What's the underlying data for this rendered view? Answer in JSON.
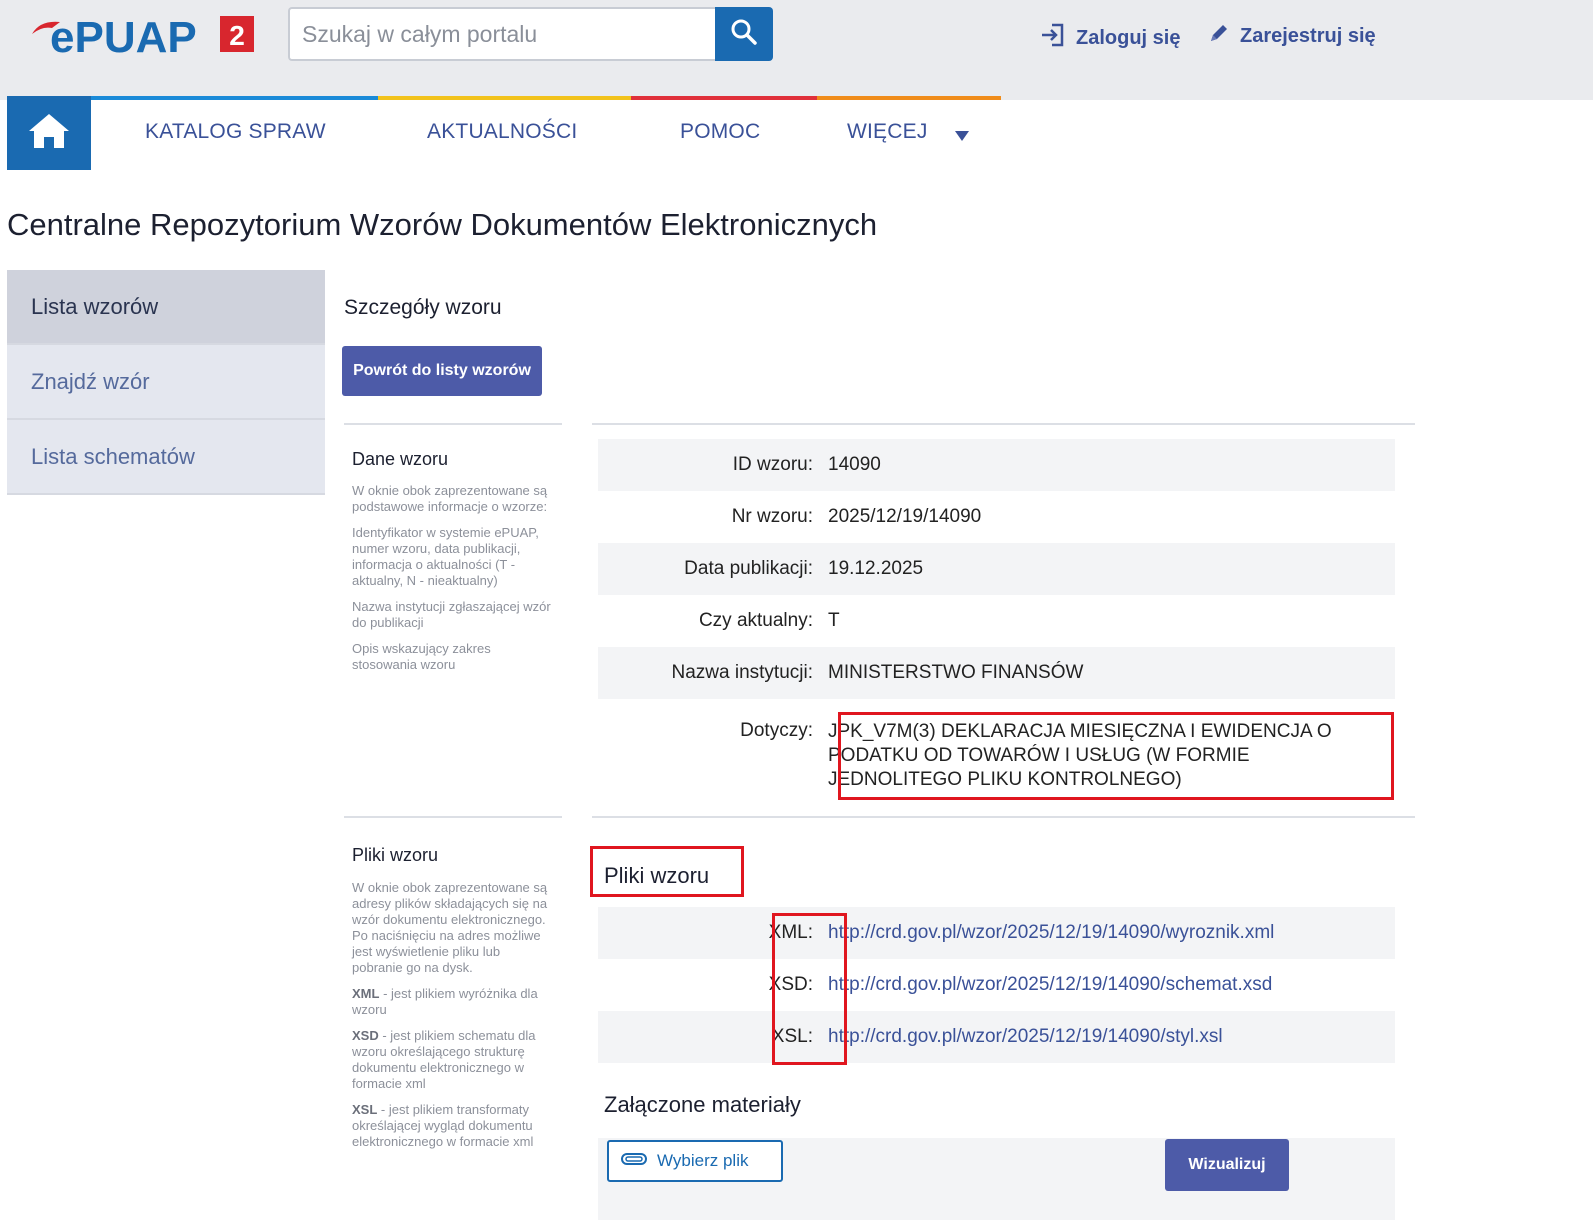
{
  "header": {
    "logo_text": "ePUAP",
    "logo_badge": "2",
    "search_placeholder": "Szukaj w całym portalu",
    "login_label": "Zaloguj się",
    "register_label": "Zarejestruj się"
  },
  "nav": {
    "items": [
      "KATALOG SPRAW",
      "AKTUALNOŚCI",
      "POMOC",
      "WIĘCEJ"
    ],
    "stripe_colors": [
      "#1a8ad8",
      "#f2c21b",
      "#e0303a",
      "#f08c1a"
    ]
  },
  "page_title": "Centralne Repozytorium Wzorów Dokumentów Elektronicznych",
  "sidebar": {
    "items": [
      "Lista wzorów",
      "Znajdź wzór",
      "Lista schematów"
    ]
  },
  "main": {
    "title": "Szczegóły wzoru",
    "back_button": "Powrót do listy wzorów",
    "dane": {
      "heading": "Dane wzoru",
      "desc": [
        "W oknie obok zaprezentowane są podstawowe informacje o wzorze:",
        "Identyfikator w systemie ePUAP, numer wzoru, data publikacji, informacja o aktualności (T - aktualny, N - nieaktualny)",
        "Nazwa instytucji zgłaszającej wzór do publikacji",
        "Opis wskazujący zakres stosowania wzoru"
      ],
      "fields": [
        {
          "label": "ID wzoru:",
          "value": "14090"
        },
        {
          "label": "Nr wzoru:",
          "value": "2025/12/19/14090"
        },
        {
          "label": "Data publikacji:",
          "value": "19.12.2025"
        },
        {
          "label": "Czy aktualny:",
          "value": "T"
        },
        {
          "label": "Nazwa instytucji:",
          "value": "MINISTERSTWO FINANSÓW"
        },
        {
          "label": "Dotyczy:",
          "value": "JPK_V7M(3) DEKLARACJA MIESIĘCZNA I EWIDENCJA O PODATKU OD TOWARÓW I USŁUG (W FORMIE JEDNOLITEGO PLIKU KONTROLNEGO)"
        }
      ]
    },
    "pliki": {
      "heading": "Pliki wzoru",
      "section_title": "Pliki wzoru",
      "desc": [
        "W oknie obok zaprezentowane są adresy plików składających się na wzór dokumentu elektronicznego. Po naciśnięciu na adres możliwe jest wyświetlenie pliku lub pobranie go na dysk."
      ],
      "desc_items": [
        {
          "key": "XML",
          "text": " - jest plikiem wyróżnika dla wzoru"
        },
        {
          "key": "XSD",
          "text": " - jest plikiem schematu dla wzoru określającego strukturę dokumentu elektronicznego w formacie xml"
        },
        {
          "key": "XSL",
          "text": " - jest plikiem transformaty określającej wygląd dokumentu elektronicznego w formacie xml"
        }
      ],
      "files": [
        {
          "label": "XML:",
          "url": "http://crd.gov.pl/wzor/2025/12/19/14090/wyroznik.xml"
        },
        {
          "label": "XSD:",
          "url": "http://crd.gov.pl/wzor/2025/12/19/14090/schemat.xsd"
        },
        {
          "label": "XSL:",
          "url": "http://crd.gov.pl/wzor/2025/12/19/14090/styl.xsl"
        }
      ]
    },
    "materialy": {
      "title": "Załączone materiały",
      "choose_file": "Wybierz plik",
      "visualize": "Wizualizuj"
    }
  }
}
